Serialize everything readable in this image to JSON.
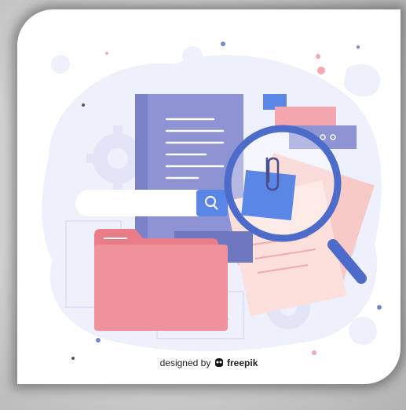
{
  "credit": {
    "prefix": "designed by",
    "brand": "freepik"
  },
  "icons": [
    "search-icon",
    "paperclip-icon",
    "more-dots-icon",
    "freepik-logo-icon"
  ],
  "colors": {
    "blob": "#eceefc",
    "document": "#8b92d1",
    "folder": "#ec8d97",
    "magnifier": "#4d6bc9",
    "note": "#5a86e6",
    "paper": "#f9d3cf",
    "card_shadow": "#6f6f6f"
  }
}
